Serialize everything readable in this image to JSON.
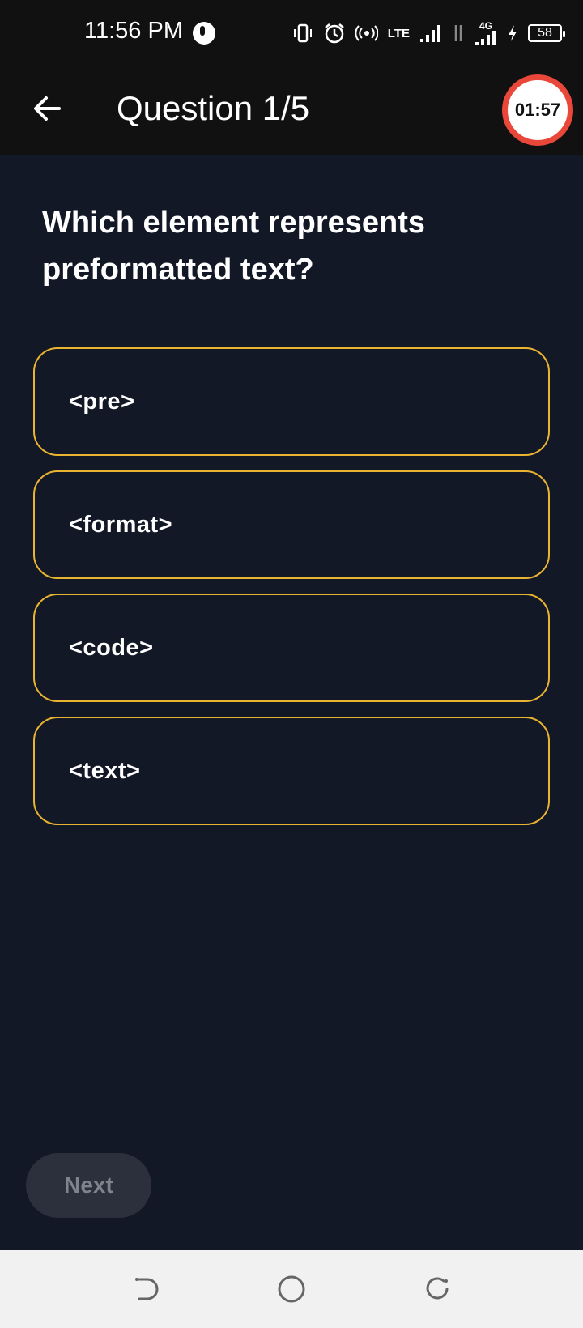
{
  "status_bar": {
    "time": "11:56 PM",
    "network_lte": "LTE",
    "network_4g": "4G",
    "battery_level": "58",
    "icons": [
      "vibrate-icon",
      "alarm-icon",
      "hotspot-icon",
      "volte-icon",
      "signal-icon",
      "data-arrows-icon",
      "signal-4g-icon",
      "charging-icon",
      "battery-icon"
    ]
  },
  "app_bar": {
    "title": "Question 1/5",
    "timer": "01:57",
    "timer_color": "#e8473a"
  },
  "question": {
    "text": "Which element represents preformatted text?"
  },
  "options": [
    {
      "label": "<pre>"
    },
    {
      "label": "<format>"
    },
    {
      "label": "<code>"
    },
    {
      "label": "<text>"
    }
  ],
  "next_button": {
    "label": "Next",
    "enabled": false
  },
  "colors": {
    "background": "#131826",
    "option_border": "#e9b430",
    "bar": "#111111"
  }
}
